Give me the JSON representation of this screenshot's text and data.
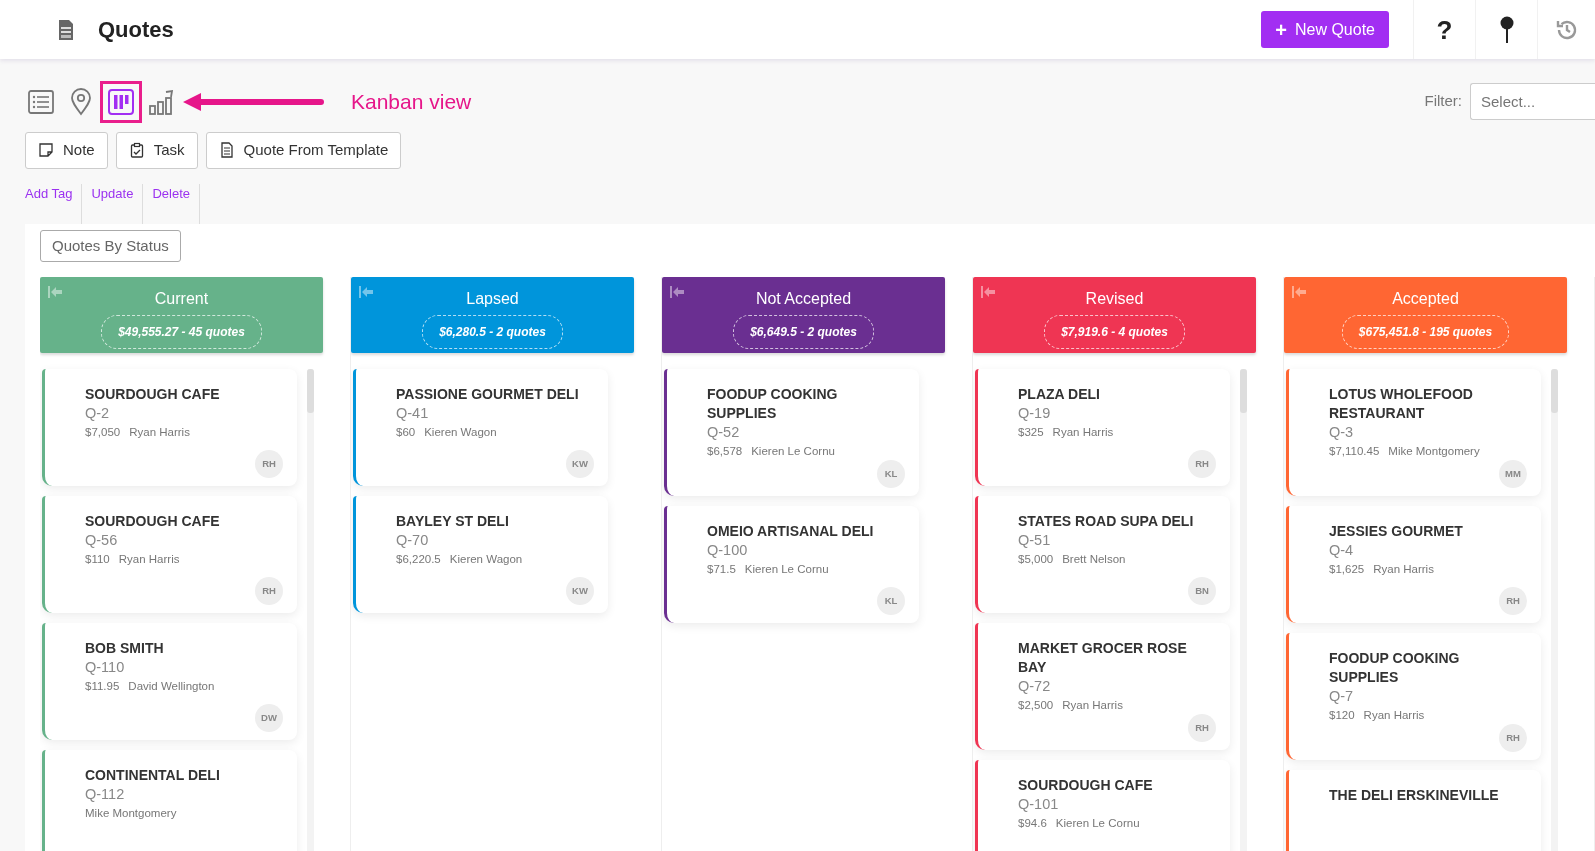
{
  "header": {
    "title": "Quotes",
    "new_button": {
      "icon": "+",
      "label": "New Quote"
    },
    "help": "?"
  },
  "view_modes": [
    {
      "kind": "list",
      "selected": false
    },
    {
      "kind": "map",
      "selected": false
    },
    {
      "kind": "kanban",
      "selected": true
    },
    {
      "kind": "chart",
      "selected": false
    }
  ],
  "annotation": {
    "text": "Kanban view"
  },
  "filter": {
    "label": "Filter:",
    "placeholder": "Select..."
  },
  "actions": [
    {
      "kind": "note",
      "label": "Note"
    },
    {
      "kind": "task",
      "label": "Task"
    },
    {
      "kind": "template",
      "label": "Quote From Template"
    }
  ],
  "links": [
    "Add Tag",
    "Update",
    "Delete"
  ],
  "board": {
    "title": "Quotes By Status",
    "columns": [
      {
        "name": "Current",
        "summary": "$49,555.27 - 45 quotes",
        "color": "#66b28a",
        "scrollable": true,
        "cards": [
          {
            "title": "SOURDOUGH CAFE",
            "quote": "Q-2",
            "amount": "$7,050",
            "person": "Ryan Harris",
            "initials": "RH"
          },
          {
            "title": "SOURDOUGH CAFE",
            "quote": "Q-56",
            "amount": "$110",
            "person": "Ryan Harris",
            "initials": "RH"
          },
          {
            "title": "BOB SMITH",
            "quote": "Q-110",
            "amount": "$11.95",
            "person": "David Wellington",
            "initials": "DW"
          },
          {
            "title": "CONTINENTAL DELI",
            "quote": "Q-112",
            "person": "Mike Montgomery"
          }
        ]
      },
      {
        "name": "Lapsed",
        "summary": "$6,280.5 - 2 quotes",
        "color": "#0095db",
        "scrollable": false,
        "cards": [
          {
            "title": "PASSIONE GOURMET DELI",
            "quote": "Q-41",
            "amount": "$60",
            "person": "Kieren Wagon",
            "initials": "KW"
          },
          {
            "title": "BAYLEY ST DELI",
            "quote": "Q-70",
            "amount": "$6,220.5",
            "person": "Kieren Wagon",
            "initials": "KW"
          }
        ]
      },
      {
        "name": "Not Accepted",
        "summary": "$6,649.5 - 2 quotes",
        "color": "#6a2f91",
        "scrollable": false,
        "cards": [
          {
            "title": "FOODUP COOKING SUPPLIES",
            "quote": "Q-52",
            "amount": "$6,578",
            "person": "Kieren Le Cornu",
            "initials": "KL"
          },
          {
            "title": "OMEIO ARTISANAL DELI",
            "quote": "Q-100",
            "amount": "$71.5",
            "person": "Kieren Le Cornu",
            "initials": "KL"
          }
        ]
      },
      {
        "name": "Revised",
        "summary": "$7,919.6 - 4 quotes",
        "color": "#ef3553",
        "scrollable": true,
        "cards": [
          {
            "title": "PLAZA DELI",
            "quote": "Q-19",
            "amount": "$325",
            "person": "Ryan Harris",
            "initials": "RH"
          },
          {
            "title": "STATES ROAD SUPA DELI",
            "quote": "Q-51",
            "amount": "$5,000",
            "person": "Brett Nelson",
            "initials": "BN"
          },
          {
            "title": "MARKET GROCER ROSE BAY",
            "quote": "Q-72",
            "amount": "$2,500",
            "person": "Ryan Harris",
            "initials": "RH"
          },
          {
            "title": "SOURDOUGH CAFE",
            "quote": "Q-101",
            "amount": "$94.6",
            "person": "Kieren Le Cornu"
          }
        ]
      },
      {
        "name": "Accepted",
        "summary": "$675,451.8 - 195 quotes",
        "color": "#ff6633",
        "scrollable": true,
        "cards": [
          {
            "title": "LOTUS WHOLEFOOD RESTAURANT",
            "quote": "Q-3",
            "amount": "$7,110.45",
            "person": "Mike Montgomery",
            "initials": "MM"
          },
          {
            "title": "JESSIES GOURMET",
            "quote": "Q-4",
            "amount": "$1,625",
            "person": "Ryan Harris",
            "initials": "RH"
          },
          {
            "title": "FOODUP COOKING SUPPLIES",
            "quote": "Q-7",
            "amount": "$120",
            "person": "Ryan Harris",
            "initials": "RH"
          },
          {
            "title": "THE DELI ERSKINEVILLE"
          }
        ]
      }
    ]
  }
}
